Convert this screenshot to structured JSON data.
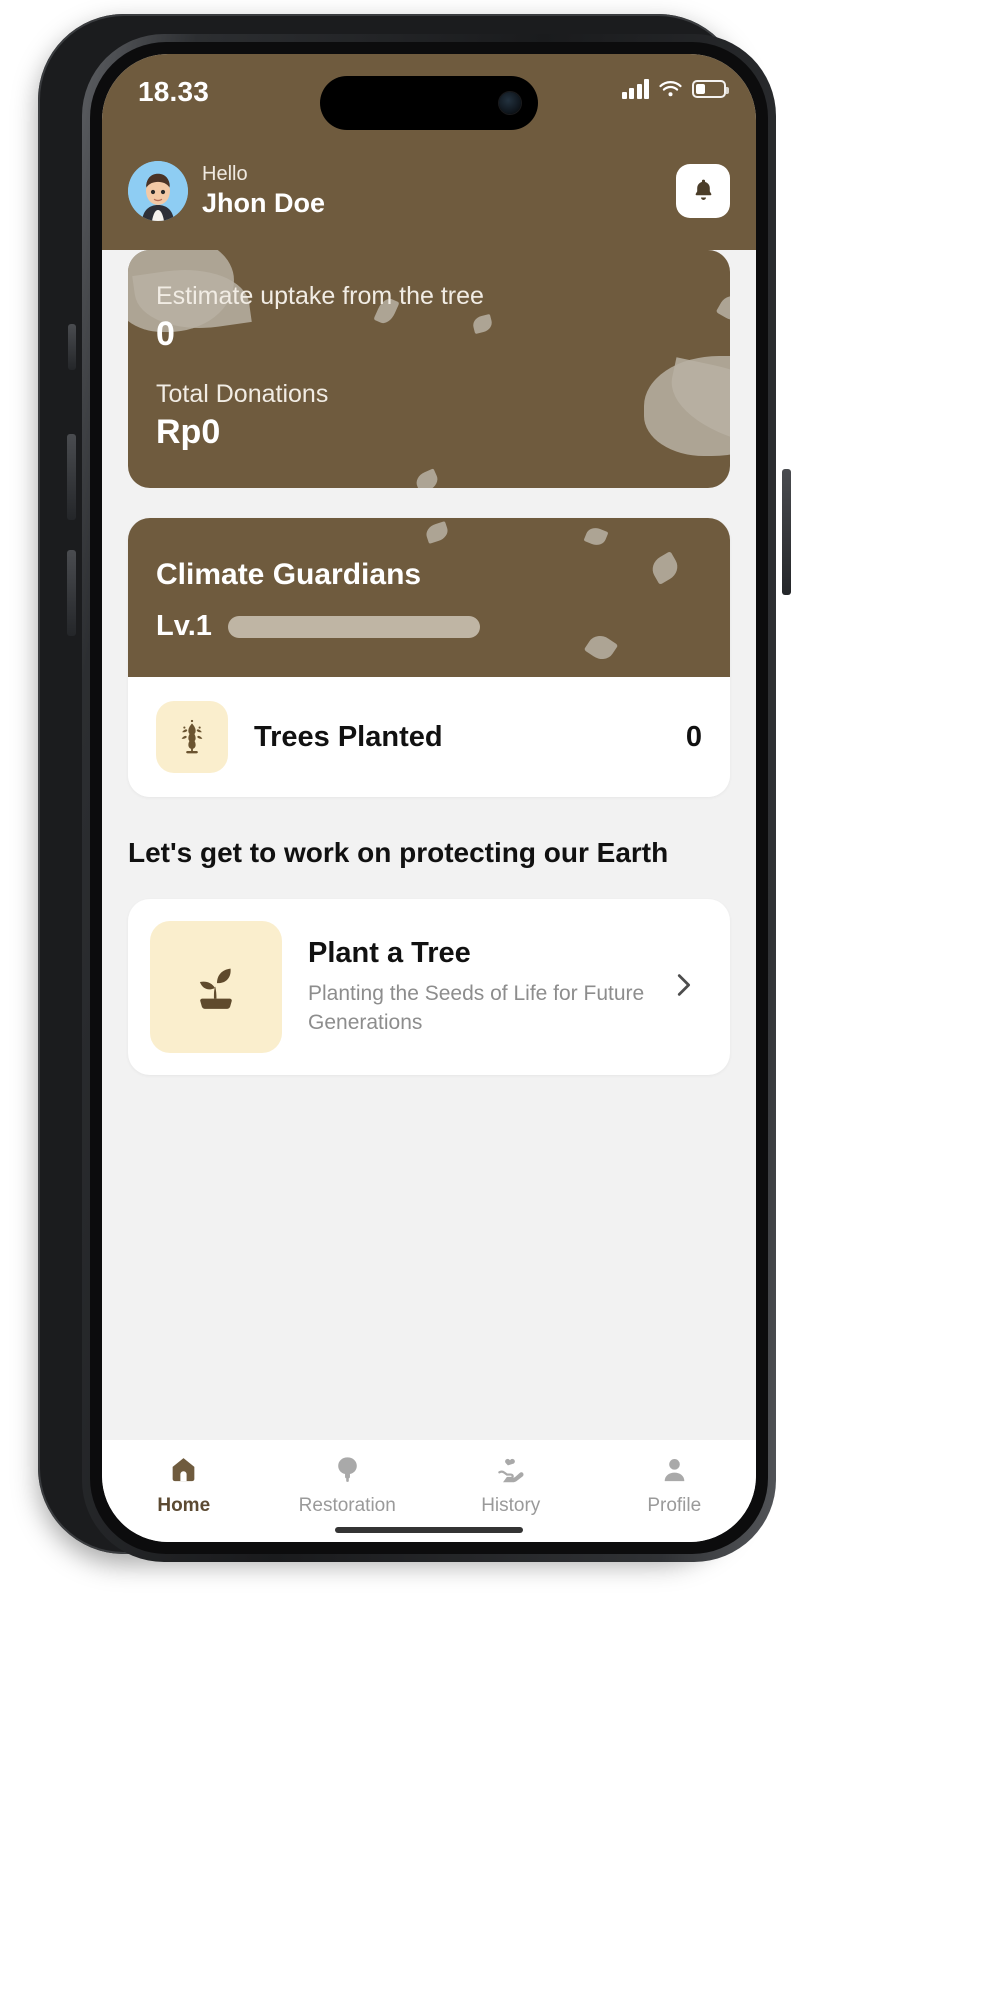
{
  "status_bar": {
    "time": "18.33",
    "signal_icon": "cellular-signal-icon",
    "wifi_icon": "wifi-icon",
    "battery_icon": "battery-icon",
    "battery_level": "30"
  },
  "header": {
    "greeting": "Hello",
    "user_name": "Jhon Doe",
    "avatar_icon": "user-avatar",
    "notification_icon": "bell-icon"
  },
  "stats_card": {
    "uptake_label": "Estimate uptake from the tree",
    "uptake_value": "0",
    "donations_label": "Total Donations",
    "donations_value": "Rp0"
  },
  "guardians": {
    "title": "Climate Guardians",
    "level": "Lv.1",
    "progress_percent": "0",
    "trees_icon": "tree-sprout-icon",
    "trees_label": "Trees Planted",
    "trees_value": "0"
  },
  "section": {
    "title": "Let's get to work on protecting our Earth"
  },
  "action_card": {
    "icon": "seedling-icon",
    "title": "Plant a Tree",
    "description": "Planting the Seeds of Life for Future Generations",
    "chevron_icon": "chevron-right-icon"
  },
  "tabbar": {
    "items": [
      {
        "label": "Home",
        "icon": "home-icon",
        "active": true
      },
      {
        "label": "Restoration",
        "icon": "tree-icon",
        "active": false
      },
      {
        "label": "History",
        "icon": "hand-heart-icon",
        "active": false
      },
      {
        "label": "Profile",
        "icon": "person-icon",
        "active": false
      }
    ]
  },
  "colors": {
    "brand_brown": "#6f5b3e",
    "page_bg": "#f2f2f2",
    "tile_cream": "#faeecd",
    "progress_track": "#bfb5a4",
    "muted_text": "#8d8d8d"
  }
}
